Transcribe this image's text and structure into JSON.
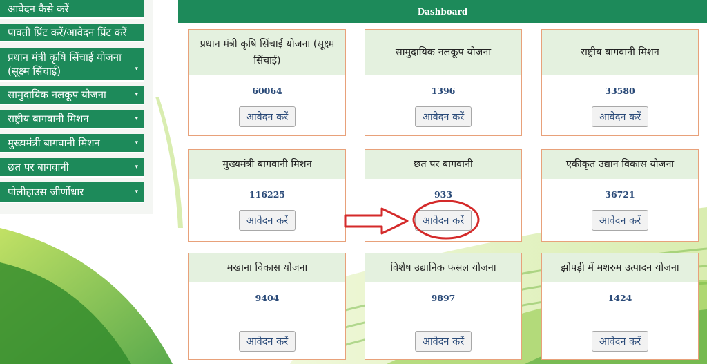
{
  "sidebar": {
    "items": [
      {
        "label": "आवेदन कैसे करें",
        "has_caret": false
      },
      {
        "label": "पावती प्रिंट करें/आवेदन प्रिंट करें",
        "has_caret": false
      },
      {
        "label": "प्रधान मंत्री कृषि सिंचाई योजना (सूक्ष्म सिंचाई)",
        "has_caret": true
      },
      {
        "label": "सामुदायिक नलकूप योजना",
        "has_caret": true
      },
      {
        "label": "राष्ट्रीय बागवानी मिशन",
        "has_caret": true
      },
      {
        "label": "मुख्यमंत्री बागवानी मिशन",
        "has_caret": true
      },
      {
        "label": "छत पर बागवानी",
        "has_caret": true
      },
      {
        "label": "पोलीहाउस जीर्णोधार",
        "has_caret": true
      }
    ],
    "caret_glyph": "▾"
  },
  "dashboard": {
    "title": "Dashboard",
    "apply_label": "आवेदन करें",
    "cards": [
      {
        "title": "प्रधान मंत्री कृषि सिंचाई योजना (सूक्ष्म सिंचाई)",
        "count": "60064"
      },
      {
        "title": "सामुदायिक नलकूप योजना",
        "count": "1396"
      },
      {
        "title": "राष्ट्रीय बागवानी मिशन",
        "count": "33580"
      },
      {
        "title": "मुख्यमंत्री बागवानी मिशन",
        "count": "116225"
      },
      {
        "title": "छत पर बागवानी",
        "count": "933"
      },
      {
        "title": "एकीकृत उद्यान विकास योजना",
        "count": "36721"
      },
      {
        "title": "मखाना विकास योजना",
        "count": "9404"
      },
      {
        "title": "विशेष उद्यानिक फसल योजना",
        "count": "9897"
      },
      {
        "title": "झोपड़ी में मशरुम उत्पादन योजना",
        "count": "1424"
      }
    ]
  },
  "colors": {
    "brand_green": "#1d8a5a",
    "card_head_bg": "#e4f1df",
    "card_border": "#e8a17a",
    "annotation_red": "#d42a2a",
    "count_text": "#2a4a78"
  }
}
